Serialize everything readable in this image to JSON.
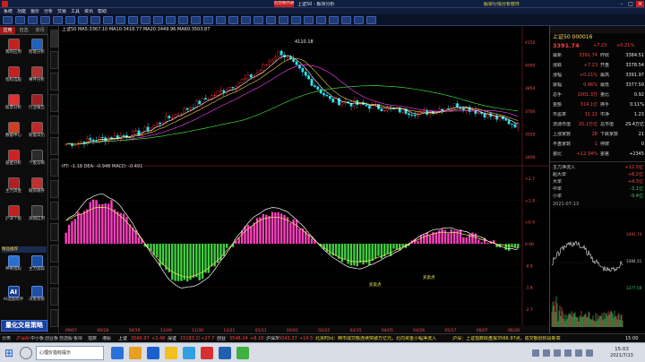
{
  "window": {
    "title": "上证50 - 板块分析",
    "notice_label": "后台服务器",
    "account_label": "股票行情分析软件"
  },
  "menu": [
    "系统",
    "功能",
    "报价",
    "分析",
    "交易",
    "工具",
    "资讯",
    "帮助"
  ],
  "left_tabs": [
    "应用",
    "自选",
    "资讯"
  ],
  "left_apps": [
    {
      "label": "我的应用",
      "color": "#c42020"
    },
    {
      "label": "智能分析",
      "color": "#2060c0"
    },
    {
      "label": "指标选股",
      "color": "#c42020"
    },
    {
      "label": "事件分析",
      "color": "#b03030"
    },
    {
      "label": "股票分析",
      "color": "#e03030"
    },
    {
      "label": "行业报告",
      "color": "#a02020"
    },
    {
      "label": "数据中心",
      "color": "#d04020"
    },
    {
      "label": "新股日历",
      "color": "#c02828"
    },
    {
      "label": "基金分析",
      "color": "#d02020"
    },
    {
      "label": "个股诊断",
      "color": "#2a2a2a"
    },
    {
      "label": "主力资金",
      "color": "#b02020"
    },
    {
      "label": "融资融券",
      "color": "#c03030"
    },
    {
      "label": "沪深个股",
      "color": "#c02020"
    },
    {
      "label": "添加应用",
      "color": "#333333"
    }
  ],
  "left_promo": {
    "header": "精品推荐",
    "items": [
      {
        "label": "神奇指标",
        "color": "#2a6fd0"
      },
      {
        "label": "主力追踪",
        "color": "#1a4fa0"
      },
      {
        "label": "AI选股助手",
        "color": "#1a3f90",
        "glyph": "AI"
      },
      {
        "label": "决策系统",
        "color": "#2050a0"
      }
    ],
    "banner": "量化交易策略"
  },
  "chart": {
    "header": "上证50  MA5:3367.10  MA10:3418.77  MA20:3449.96  MA60:3503.87",
    "top_label": "4110.18",
    "price_ticks": [
      "4150",
      "4000",
      "3850",
      "3700",
      "3550",
      "3400"
    ],
    "osc_header": "IFT: -1.18  DEA: -0.948  MACD: -0.491",
    "osc_ticks": [
      "+2.7",
      "+1.8",
      "+0.9",
      "0.00",
      "-0.9",
      "-1.8",
      "-2.7"
    ],
    "annotations": [
      "买卖点",
      "买卖点"
    ],
    "date_labels": [
      "09/07",
      "09/28",
      "10/19",
      "11/09",
      "11/30",
      "12/21",
      "01/11",
      "02/01",
      "02/22",
      "03/15",
      "04/05",
      "04/26",
      "05/17",
      "06/07",
      "06/28"
    ]
  },
  "right": {
    "title": "上证50 000016",
    "price": "3391.74",
    "change": "+7.23",
    "pct": "+0.21%",
    "rows": [
      {
        "k": "最新",
        "v": "3391.74",
        "k2": "昨收",
        "v2": "3384.51"
      },
      {
        "k": "涨跌",
        "v": "+7.23",
        "k2": "开盘",
        "v2": "3378.54"
      },
      {
        "k": "涨幅",
        "v": "+0.21%",
        "k2": "最高",
        "v2": "3391.97"
      },
      {
        "k": "振幅",
        "v": "0.96%",
        "k2": "最低",
        "v2": "3377.59"
      },
      {
        "k": "总手",
        "v": "1001.3万",
        "k2": "量比",
        "v2": "0.92"
      },
      {
        "k": "金额",
        "v": "314.1亿",
        "k2": "换手",
        "v2": "0.11%"
      },
      {
        "k": "市盈率",
        "v": "11.22",
        "k2": "市净",
        "v2": "1.23"
      },
      {
        "k": "流通市值",
        "v": "20.1万亿",
        "k2": "总市值",
        "v2": "29.4万亿"
      },
      {
        "k": "上涨家数",
        "v": "28",
        "k2": "下跌家数",
        "v2": "21"
      },
      {
        "k": "平盘家数",
        "v": "1",
        "k2": "停牌",
        "v2": "0"
      },
      {
        "k": "委比",
        "v": "+12.34%",
        "k2": "委差",
        "v2": "+2345"
      }
    ],
    "fund_rows": [
      {
        "k": "主力净流入",
        "v": "+12.5亿"
      },
      {
        "k": "超大单",
        "v": "+8.2亿"
      },
      {
        "k": "大单",
        "v": "+4.3亿"
      },
      {
        "k": "中单",
        "v": "-3.1亿"
      },
      {
        "k": "小单",
        "v": "-9.4亿"
      }
    ],
    "mini_date": "2021-07-13",
    "mini_ticks": [
      "3391.74",
      "3384.51",
      "3377.59"
    ]
  },
  "bottom": {
    "tabs": [
      "分类",
      "沪深A股",
      "中小板",
      "创业板",
      "自选股",
      "板块",
      "指数",
      "港股"
    ],
    "quotes": [
      {
        "name": "上证",
        "value": "3566.97",
        "chg": "+2.48"
      },
      {
        "name": "深证",
        "value": "15183.29",
        "chg": "+27.77"
      },
      {
        "name": "创业",
        "value": "3548.24",
        "chg": "+8.18"
      },
      {
        "name": "沪深300",
        "value": "5043.37",
        "chg": "+14.59"
      }
    ],
    "news1": "北京时间：两市成交额连续突破万亿元，北向资金小幅净流入",
    "news2": "沪深：上证指数收盘报3566.97点，成交额创阶段新高",
    "time": "15:00"
  },
  "taskbar": {
    "window_label": "心理价指标提示",
    "clock_time": "15:03",
    "clock_date": "2021/7/13"
  }
}
